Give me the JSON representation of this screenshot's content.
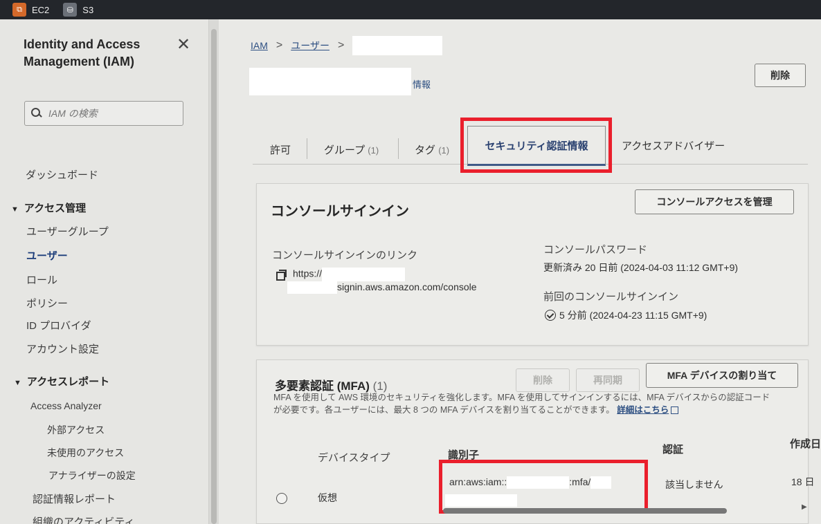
{
  "topbar": {
    "services": [
      {
        "label": "EC2",
        "icon": "ec2-icon"
      },
      {
        "label": "S3",
        "icon": "s3-icon"
      }
    ]
  },
  "sidebar": {
    "title": "Identity and Access Management (IAM)",
    "search_placeholder": "IAM の検索",
    "dashboard": "ダッシュボード",
    "access_management": "アクセス管理",
    "items": [
      "ユーザーグループ",
      "ユーザー",
      "ロール",
      "ポリシー",
      "ID プロバイダ",
      "アカウント設定"
    ],
    "access_reports": "アクセスレポート",
    "analyzer": "Access Analyzer",
    "analyzer_items": [
      "外部アクセス",
      "未使用のアクセス",
      "アナライザーの設定"
    ],
    "credential_report": "認証情報レポート",
    "org_activity": "組織のアクティビティ"
  },
  "breadcrumb": {
    "iam": "IAM",
    "users": "ユーザー"
  },
  "header": {
    "info": "情報",
    "delete_button": "削除"
  },
  "tabs": {
    "permissions": "許可",
    "groups": "グループ",
    "groups_count": "(1)",
    "tags": "タグ",
    "tags_count": "(1)",
    "security_credentials": "セキュリティ認証情報",
    "access_advisor": "アクセスアドバイザー"
  },
  "console_signin": {
    "title": "コンソールサインイン",
    "manage_button": "コンソールアクセスを管理",
    "link_label": "コンソールサインインのリンク",
    "link_prefix": "https://",
    "link_suffix": "signin.aws.amazon.com/console",
    "password_label": "コンソールパスワード",
    "password_value": "更新済み 20 日前 (2024-04-03 11:12 GMT+9)",
    "last_signin_label": "前回のコンソールサインイン",
    "last_signin_value": "5 分前 (2024-04-23 11:15 GMT+9)"
  },
  "mfa": {
    "title": "多要素認証 (MFA)",
    "count": "(1)",
    "delete_button": "削除",
    "resync_button": "再同期",
    "assign_button": "MFA デバイスの割り当て",
    "desc_line1": "MFA を使用して AWS 環境のセキュリティを強化します。MFA を使用してサインインするには、MFA デバイスからの認証コード",
    "desc_line2": "が必要です。各ユーザーには、最大 8 つの MFA デバイスを割り当てることができます。",
    "learn_more": "詳細はこちら",
    "columns": {
      "device_type": "デバイスタイプ",
      "identifier": "識別子",
      "certification": "認証",
      "created": "作成日"
    },
    "row": {
      "device_type": "仮想",
      "arn_prefix": "arn:aws:iam::",
      "arn_mid": ":mfa/",
      "certification": "該当しません",
      "created": "18 日"
    }
  },
  "colors": {
    "highlight": "#ea1f2c",
    "link": "#2d4f82",
    "topbar": "#23262b"
  }
}
